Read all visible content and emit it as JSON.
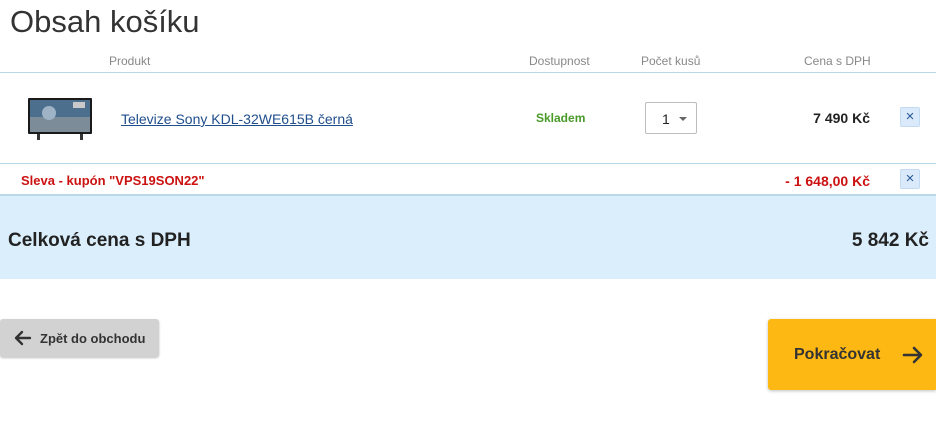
{
  "page": {
    "title": "Obsah košíku"
  },
  "columns": {
    "product": "Produkt",
    "availability": "Dostupnost",
    "quantity": "Počet kusů",
    "price": "Cena s DPH"
  },
  "items": [
    {
      "thumbnail_icon": "tv-icon",
      "name": "Televize Sony KDL-32WE615B černá",
      "availability": "Skladem",
      "availability_color": "#4a9a2a",
      "quantity": "1",
      "price": "7 490 Kč"
    }
  ],
  "discount": {
    "label": "Sleva - kupón \"VPS19SON22\"",
    "amount": "- 1 648,00 Kč",
    "color": "#cc1111"
  },
  "total": {
    "label": "Celková cena s DPH",
    "value": "5 842 Kč",
    "background": "#dbeefc"
  },
  "actions": {
    "back_label": "Zpět do obchodu",
    "continue_label": "Pokračovat",
    "continue_color": "#fdb813",
    "remove_icon": "close-icon"
  }
}
